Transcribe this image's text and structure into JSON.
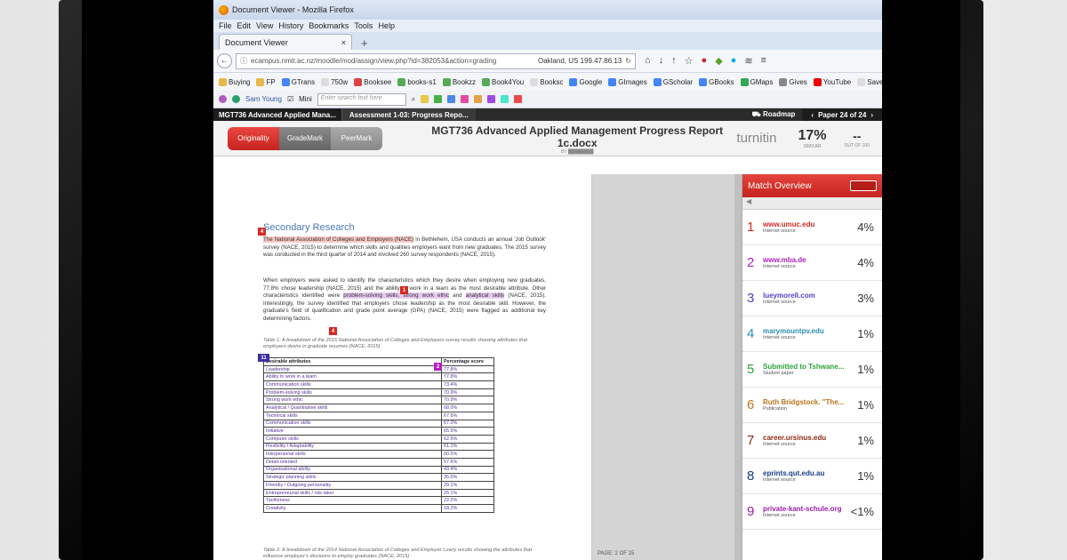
{
  "browser": {
    "window_title": "Document Viewer - Mozilla Firefox",
    "menu": [
      "File",
      "Edit",
      "View",
      "History",
      "Bookmarks",
      "Tools",
      "Help"
    ],
    "tab_title": "Document Viewer",
    "url": "ecampus.nmit.ac.nz/moodle/mod/assign/view.php?id=382053&action=grading",
    "location": "Oakland, US 199.47.86.13",
    "bookmarks": [
      "Buying",
      "FP",
      "GTrans",
      "750w",
      "Booksee",
      "books-s1",
      "Bookzz",
      "Book4You",
      "Booksc",
      "Google",
      "GImages",
      "GScholar",
      "GBooks",
      "GMaps",
      "Gives",
      "YouTube",
      "Save Video Me"
    ],
    "toolbar_user": "Sam Young",
    "toolbar_mini": "Mini",
    "toolbar_search_placeholder": "Enter search text here"
  },
  "moodle": {
    "course": "MGT736 Advanced Applied Mana...",
    "assessment": "Assessment 1-03: Progress Repo...",
    "roadmap": "Roadmap",
    "page": "Paper 24 of 24"
  },
  "turnitin": {
    "modes": [
      "Originality",
      "GradeMark",
      "PeerMark"
    ],
    "doc_title": "MGT736 Advanced Applied Management Progress Report 1c.docx",
    "logo": "turnitin",
    "similarity": "17%",
    "similarity_label": "SIMILAR",
    "grade": "--",
    "grade_label": "OUT OF 100",
    "page_indicator": "PAGE: 2 OF 15"
  },
  "document": {
    "heading": "Secondary Research",
    "para1_hl": "The National Association of Colleges and Employers (NACE)",
    "para1_rest": " in Bethlehem, USA conducts an annual 'Job Outlook' survey (NACE, 2015) to determine which skills and qualities employers want from new graduates. The 2015 survey was conducted in the third quarter of 2014 and involved 260 survey respondents (NACE, 2015).",
    "para2_a": "When employers were asked to identify the characteristics which they desire when employing new graduates, 77.8% chose leadership (NACE, 2015) and the ability to work in a team as the most desirable attribute. Other characteristics identified were ",
    "para2_hl1": "problem-solving skills, strong work ethic",
    "para2_b": " and ",
    "para2_hl2": "analytical skills",
    "para2_c": " (NACE, 2015). Interestingly, the survey identified that employers chose leadership as the most desirable skill. However, the graduate's field of qualification and grade point average (GPA) (NACE, 2015) were flagged as additional key determining factors.",
    "caption1": "Table 1: A breakdown of the 2015 National Association of Colleges and Employers survey results showing attributes that employers desire in graduate resumes (NACE, 2015)",
    "table_header": [
      "Desirable attributes",
      "Percentage score"
    ],
    "table_rows": [
      [
        "Leadership",
        "77.8%"
      ],
      [
        "Ability to work in a team",
        "77.8%"
      ],
      [
        "Communication skills",
        "73.4%"
      ],
      [
        "Problem-solving skills",
        "70.9%"
      ],
      [
        "Strong work ethic",
        "70.9%"
      ],
      [
        "Analytical / Quantitative skills",
        "68.0%"
      ],
      [
        "Technical skills",
        "67.5%"
      ],
      [
        "Communication skills",
        "67.0%"
      ],
      [
        "Initiative",
        "65.5%"
      ],
      [
        "Computer skills",
        "62.5%"
      ],
      [
        "Flexibility / Adaptability",
        "61.1%"
      ],
      [
        "Interpersonal skills",
        "60.5%"
      ],
      [
        "Detail-oriented",
        "57.6%"
      ],
      [
        "Organisational ability",
        "43.4%"
      ],
      [
        "Strategic planning skills",
        "35.0%"
      ],
      [
        "Friendly / Outgoing personality",
        "29.1%"
      ],
      [
        "Entrepreneurial skills / risk taker",
        "25.1%"
      ],
      [
        "Tactfulness",
        "22.2%"
      ],
      [
        "Creativity",
        "18.2%"
      ]
    ],
    "caption2": "Table 2: A breakdown of the 2014 National Association of Colleges and Employer Lowry results showing the attributes that influence employer's decisions to employ graduates (NACE, 2015)"
  },
  "matches": {
    "title": "Match Overview",
    "items": [
      {
        "num": "1",
        "name": "www.umuc.edu",
        "type": "Internet source",
        "pct": "4%",
        "color": "#d32a24"
      },
      {
        "num": "2",
        "name": "www.mba.de",
        "type": "Internet source",
        "pct": "4%",
        "color": "#b020c0"
      },
      {
        "num": "3",
        "name": "lueymorell.com",
        "type": "Internet source",
        "pct": "3%",
        "color": "#5a3fc8"
      },
      {
        "num": "4",
        "name": "marymountpv.edu",
        "type": "Internet source",
        "pct": "1%",
        "color": "#2a8fb0"
      },
      {
        "num": "5",
        "name": "Submitted to Tshwane...",
        "type": "Student paper",
        "pct": "1%",
        "color": "#2ea33a"
      },
      {
        "num": "6",
        "name": "Ruth Bridgstock. \"The...",
        "type": "Publication",
        "pct": "1%",
        "color": "#b8741c"
      },
      {
        "num": "7",
        "name": "career.ursinus.edu",
        "type": "Internet source",
        "pct": "1%",
        "color": "#8a2a10"
      },
      {
        "num": "8",
        "name": "eprints.qut.edu.au",
        "type": "Internet source",
        "pct": "1%",
        "color": "#1a3e8a"
      },
      {
        "num": "9",
        "name": "private-kant-schule.org",
        "type": "Internet source",
        "pct": "<1%",
        "color": "#9a1fa6"
      }
    ]
  }
}
